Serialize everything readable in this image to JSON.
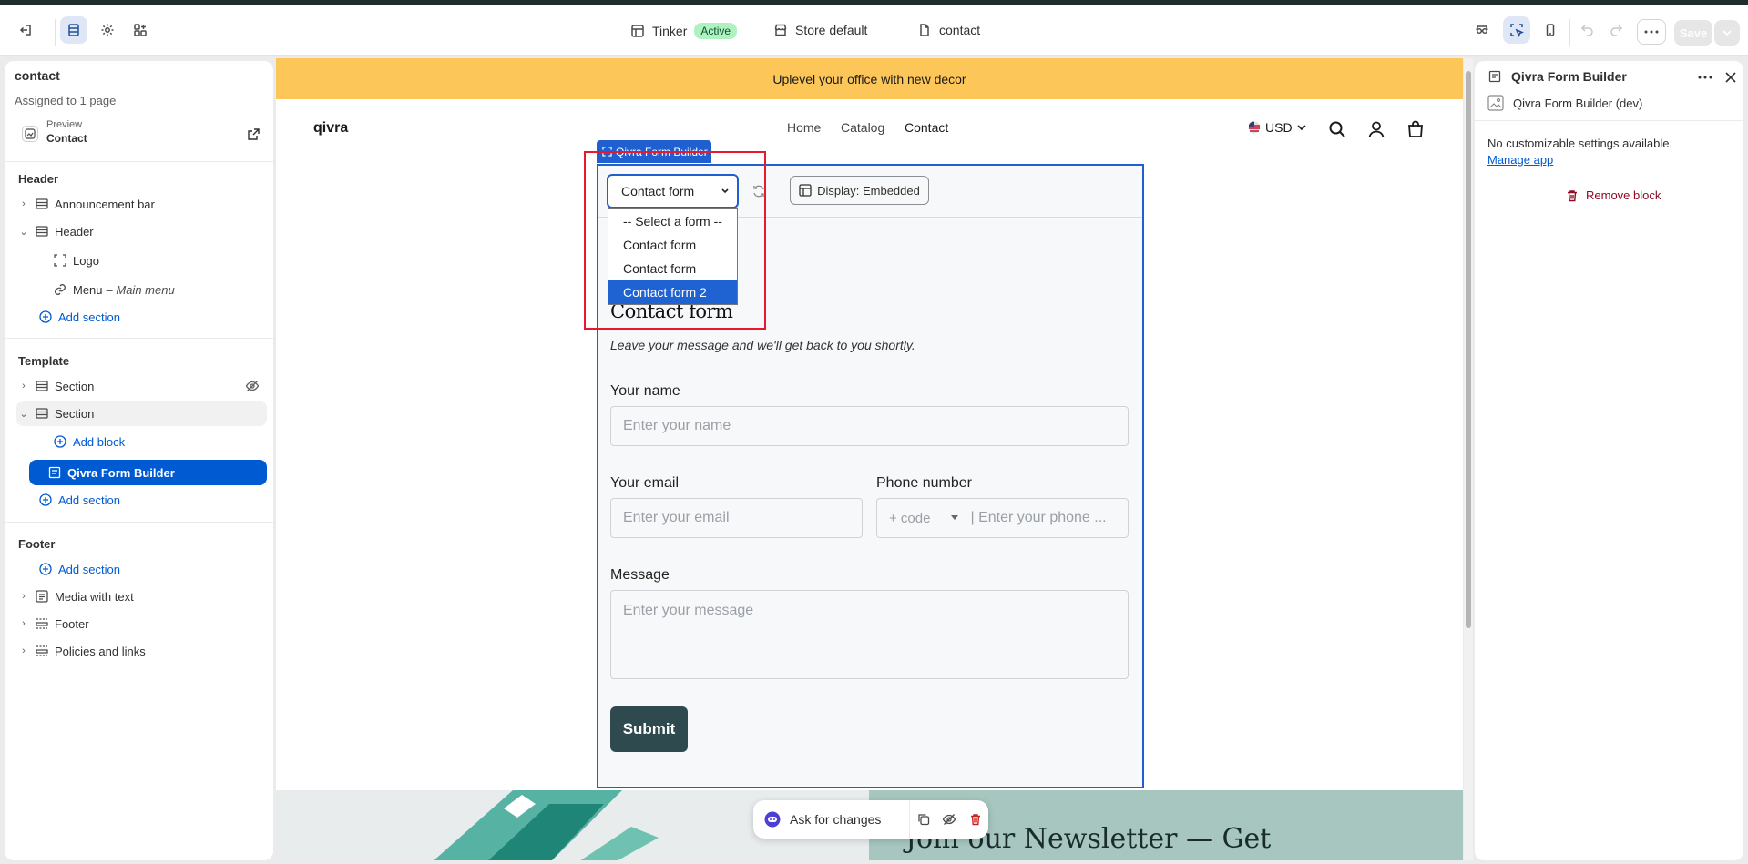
{
  "topbar": {
    "theme_name": "Tinker",
    "theme_status": "Active",
    "store_label": "Store default",
    "page_label": "contact",
    "save_label": "Save"
  },
  "left_panel": {
    "title": "contact",
    "assigned": "Assigned to 1 page",
    "preview_label": "Preview",
    "preview_value": "Contact",
    "header_group": "Header",
    "header_items": {
      "announcement": "Announcement bar",
      "header": "Header",
      "logo": "Logo",
      "menu": "Menu",
      "menu_sub": "– Main menu",
      "add_section": "Add section"
    },
    "template_group": "Template",
    "template_items": {
      "section1": "Section",
      "section2": "Section",
      "add_block": "Add block",
      "form_builder": "Qivra Form Builder",
      "add_section": "Add section"
    },
    "footer_group": "Footer",
    "footer_items": {
      "add_section": "Add section",
      "media_text": "Media with text",
      "footer": "Footer",
      "policies": "Policies and links"
    }
  },
  "storefront": {
    "announcement": "Uplevel your office with new decor",
    "logo": "qivra",
    "nav": [
      "Home",
      "Catalog",
      "Contact"
    ],
    "currency": "USD",
    "block_tag": "Qivra Form Builder",
    "form_select": {
      "value": "Contact form",
      "options": [
        "-- Select a form --",
        "Contact form",
        "Contact form",
        "Contact form 2"
      ],
      "highlighted_index": 3
    },
    "display_button": "Display: Embedded",
    "form": {
      "title": "Contact form",
      "description": "Leave your message and we'll get back to you shortly.",
      "name_label": "Your name",
      "name_placeholder": "Enter your name",
      "email_label": "Your email",
      "email_placeholder": "Enter your email",
      "phone_label": "Phone number",
      "phone_code": "+ code",
      "phone_placeholder": "| Enter your phone ...",
      "message_label": "Message",
      "message_placeholder": "Enter your message",
      "submit": "Submit"
    },
    "newsletter_title": "Join our Newsletter — Get",
    "ask_label": "Ask for changes"
  },
  "right_panel": {
    "title": "Qivra Form Builder",
    "app_name": "Qivra Form Builder (dev)",
    "no_settings": "No customizable settings available.",
    "manage_app": "Manage app",
    "remove_block": "Remove block"
  },
  "colors": {
    "accent": "#005bd3",
    "announcement_bg": "#fdc659",
    "selection_border": "#e8192c",
    "submit_bg": "#2e4a4e"
  }
}
